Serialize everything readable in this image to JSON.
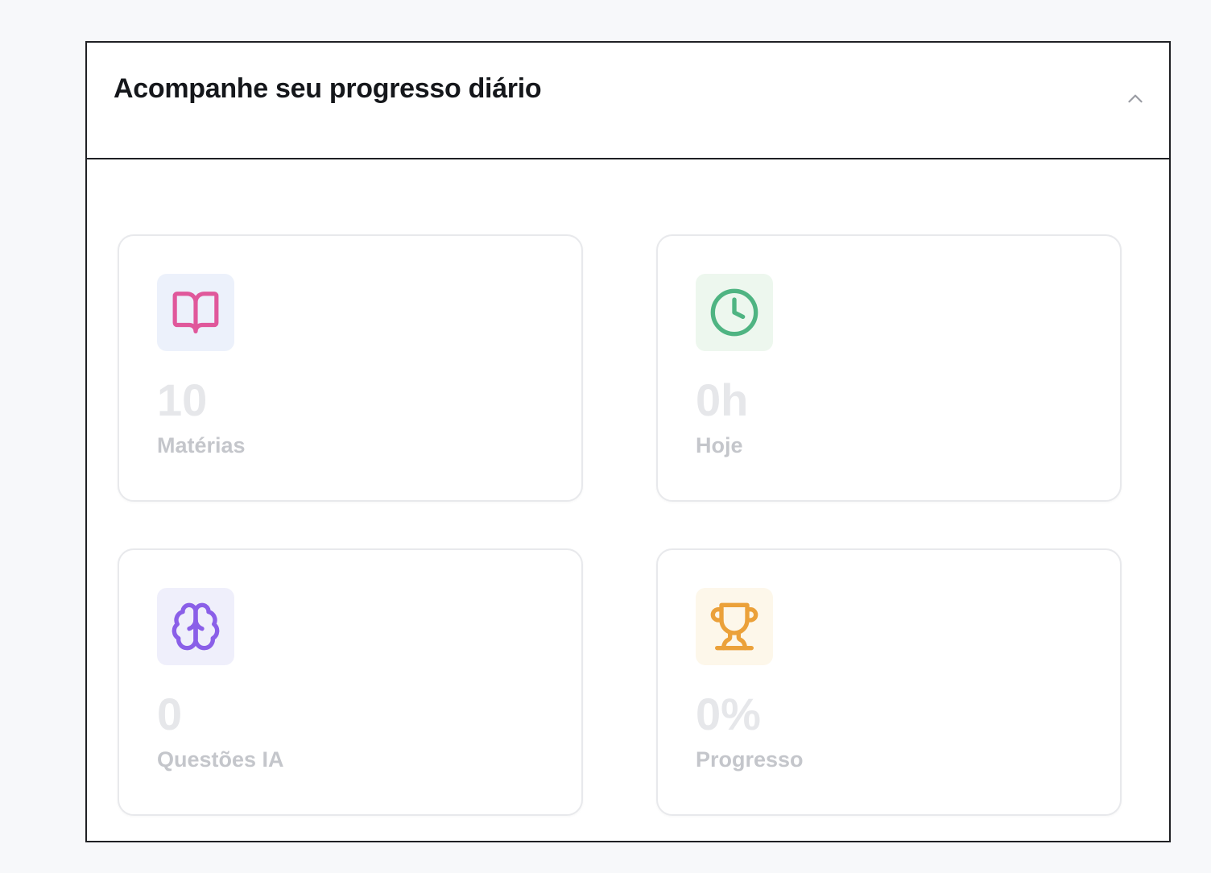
{
  "panel": {
    "title": "Acompanhe seu progresso diário",
    "collapse_icon": "chevron-up-icon"
  },
  "stats": [
    {
      "value": "10",
      "label": "Matérias",
      "icon": "book-open-icon",
      "icon_color": "#e0589b",
      "icon_bg": "#ecf1fb"
    },
    {
      "value": "0h",
      "label": "Hoje",
      "icon": "clock-icon",
      "icon_color": "#4fb482",
      "icon_bg": "#edf7ee"
    },
    {
      "value": "0",
      "label": "Questões IA",
      "icon": "brain-icon",
      "icon_color": "#8a5fe8",
      "icon_bg": "#efeffb"
    },
    {
      "value": "0%",
      "label": "Progresso",
      "icon": "trophy-icon",
      "icon_color": "#eba13a",
      "icon_bg": "#fdf7ea"
    }
  ]
}
